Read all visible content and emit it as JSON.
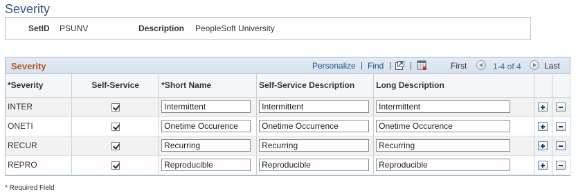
{
  "page": {
    "title": "Severity"
  },
  "key": {
    "setid_label": "SetID",
    "setid_value": "PSUNV",
    "description_label": "Description",
    "description_value": "PeopleSoft University"
  },
  "grid": {
    "title": "Severity",
    "personalize_label": "Personalize",
    "find_label": "Find",
    "separator": "|",
    "first_label": "First",
    "range_label": "1-4 of 4",
    "last_label": "Last",
    "columns": {
      "severity": "*Severity",
      "self_service": "Self-Service",
      "short_name": "*Short Name",
      "ss_description": "Self-Service Description",
      "long_description": "Long Description"
    },
    "rows": [
      {
        "severity": "INTER",
        "self_service": true,
        "short_name": "Intermittent",
        "ss_description": "Intermittent",
        "long_description": "Intermittent"
      },
      {
        "severity": "ONETI",
        "self_service": true,
        "short_name": "Onetime Occurence",
        "ss_description": "Onetime Occurrence",
        "long_description": "Onetime Occurence"
      },
      {
        "severity": "RECUR",
        "self_service": true,
        "short_name": "Recurring",
        "ss_description": "Recurring",
        "long_description": "Recurring"
      },
      {
        "severity": "REPRO",
        "self_service": true,
        "short_name": "Reproducible",
        "ss_description": "Reproducible",
        "long_description": "Reproducible"
      }
    ]
  },
  "footer": {
    "required_note": "* Required Field"
  },
  "colors": {
    "title": "#33557f",
    "grid_title": "#b1521e",
    "link": "#1f4f8c"
  },
  "icons": {
    "view_all": "new-window-icon",
    "download": "spreadsheet-icon",
    "previous": "previous-arrow-icon",
    "next": "next-arrow-icon",
    "add_row": "plus-icon",
    "delete_row": "minus-icon"
  }
}
